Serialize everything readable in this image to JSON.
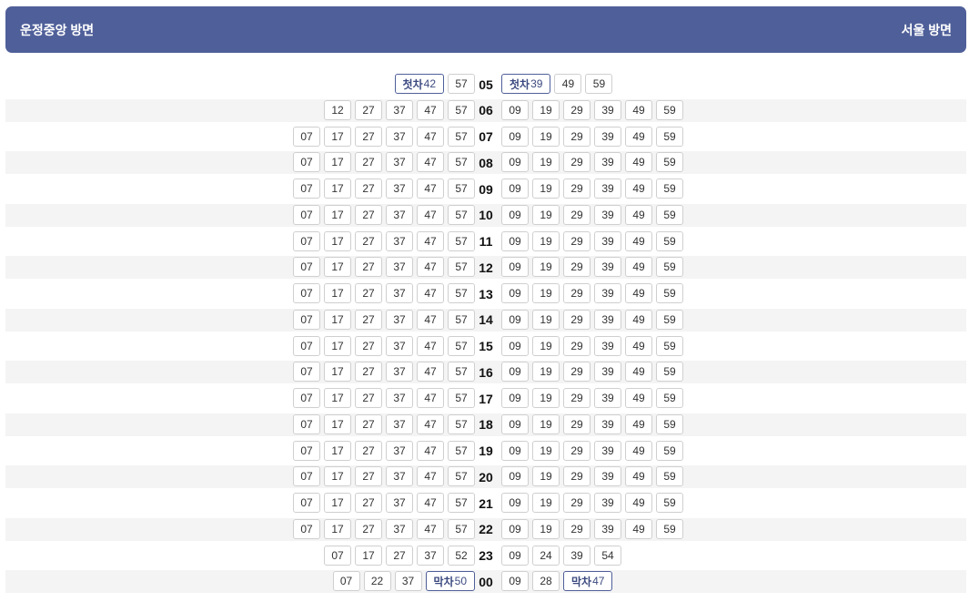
{
  "header": {
    "left_direction": "운정중앙 방면",
    "right_direction": "서울 방면"
  },
  "timetable": [
    {
      "hour": "05",
      "left": [
        {
          "t": "42",
          "label": "첫차"
        },
        {
          "t": "57"
        }
      ],
      "right": [
        {
          "t": "39",
          "label": "첫차"
        },
        {
          "t": "49"
        },
        {
          "t": "59"
        }
      ]
    },
    {
      "hour": "06",
      "left": [
        {
          "t": "12"
        },
        {
          "t": "27"
        },
        {
          "t": "37"
        },
        {
          "t": "47"
        },
        {
          "t": "57"
        }
      ],
      "right": [
        {
          "t": "09"
        },
        {
          "t": "19"
        },
        {
          "t": "29"
        },
        {
          "t": "39"
        },
        {
          "t": "49"
        },
        {
          "t": "59"
        }
      ]
    },
    {
      "hour": "07",
      "left": [
        {
          "t": "07"
        },
        {
          "t": "17"
        },
        {
          "t": "27"
        },
        {
          "t": "37"
        },
        {
          "t": "47"
        },
        {
          "t": "57"
        }
      ],
      "right": [
        {
          "t": "09"
        },
        {
          "t": "19"
        },
        {
          "t": "29"
        },
        {
          "t": "39"
        },
        {
          "t": "49"
        },
        {
          "t": "59"
        }
      ]
    },
    {
      "hour": "08",
      "left": [
        {
          "t": "07"
        },
        {
          "t": "17"
        },
        {
          "t": "27"
        },
        {
          "t": "37"
        },
        {
          "t": "47"
        },
        {
          "t": "57"
        }
      ],
      "right": [
        {
          "t": "09"
        },
        {
          "t": "19"
        },
        {
          "t": "29"
        },
        {
          "t": "39"
        },
        {
          "t": "49"
        },
        {
          "t": "59"
        }
      ]
    },
    {
      "hour": "09",
      "left": [
        {
          "t": "07"
        },
        {
          "t": "17"
        },
        {
          "t": "27"
        },
        {
          "t": "37"
        },
        {
          "t": "47"
        },
        {
          "t": "57"
        }
      ],
      "right": [
        {
          "t": "09"
        },
        {
          "t": "19"
        },
        {
          "t": "29"
        },
        {
          "t": "39"
        },
        {
          "t": "49"
        },
        {
          "t": "59"
        }
      ]
    },
    {
      "hour": "10",
      "left": [
        {
          "t": "07"
        },
        {
          "t": "17"
        },
        {
          "t": "27"
        },
        {
          "t": "37"
        },
        {
          "t": "47"
        },
        {
          "t": "57"
        }
      ],
      "right": [
        {
          "t": "09"
        },
        {
          "t": "19"
        },
        {
          "t": "29"
        },
        {
          "t": "39"
        },
        {
          "t": "49"
        },
        {
          "t": "59"
        }
      ]
    },
    {
      "hour": "11",
      "left": [
        {
          "t": "07"
        },
        {
          "t": "17"
        },
        {
          "t": "27"
        },
        {
          "t": "37"
        },
        {
          "t": "47"
        },
        {
          "t": "57"
        }
      ],
      "right": [
        {
          "t": "09"
        },
        {
          "t": "19"
        },
        {
          "t": "29"
        },
        {
          "t": "39"
        },
        {
          "t": "49"
        },
        {
          "t": "59"
        }
      ]
    },
    {
      "hour": "12",
      "left": [
        {
          "t": "07"
        },
        {
          "t": "17"
        },
        {
          "t": "27"
        },
        {
          "t": "37"
        },
        {
          "t": "47"
        },
        {
          "t": "57"
        }
      ],
      "right": [
        {
          "t": "09"
        },
        {
          "t": "19"
        },
        {
          "t": "29"
        },
        {
          "t": "39"
        },
        {
          "t": "49"
        },
        {
          "t": "59"
        }
      ]
    },
    {
      "hour": "13",
      "left": [
        {
          "t": "07"
        },
        {
          "t": "17"
        },
        {
          "t": "27"
        },
        {
          "t": "37"
        },
        {
          "t": "47"
        },
        {
          "t": "57"
        }
      ],
      "right": [
        {
          "t": "09"
        },
        {
          "t": "19"
        },
        {
          "t": "29"
        },
        {
          "t": "39"
        },
        {
          "t": "49"
        },
        {
          "t": "59"
        }
      ]
    },
    {
      "hour": "14",
      "left": [
        {
          "t": "07"
        },
        {
          "t": "17"
        },
        {
          "t": "27"
        },
        {
          "t": "37"
        },
        {
          "t": "47"
        },
        {
          "t": "57"
        }
      ],
      "right": [
        {
          "t": "09"
        },
        {
          "t": "19"
        },
        {
          "t": "29"
        },
        {
          "t": "39"
        },
        {
          "t": "49"
        },
        {
          "t": "59"
        }
      ]
    },
    {
      "hour": "15",
      "left": [
        {
          "t": "07"
        },
        {
          "t": "17"
        },
        {
          "t": "27"
        },
        {
          "t": "37"
        },
        {
          "t": "47"
        },
        {
          "t": "57"
        }
      ],
      "right": [
        {
          "t": "09"
        },
        {
          "t": "19"
        },
        {
          "t": "29"
        },
        {
          "t": "39"
        },
        {
          "t": "49"
        },
        {
          "t": "59"
        }
      ]
    },
    {
      "hour": "16",
      "left": [
        {
          "t": "07"
        },
        {
          "t": "17"
        },
        {
          "t": "27"
        },
        {
          "t": "37"
        },
        {
          "t": "47"
        },
        {
          "t": "57"
        }
      ],
      "right": [
        {
          "t": "09"
        },
        {
          "t": "19"
        },
        {
          "t": "29"
        },
        {
          "t": "39"
        },
        {
          "t": "49"
        },
        {
          "t": "59"
        }
      ]
    },
    {
      "hour": "17",
      "left": [
        {
          "t": "07"
        },
        {
          "t": "17"
        },
        {
          "t": "27"
        },
        {
          "t": "37"
        },
        {
          "t": "47"
        },
        {
          "t": "57"
        }
      ],
      "right": [
        {
          "t": "09"
        },
        {
          "t": "19"
        },
        {
          "t": "29"
        },
        {
          "t": "39"
        },
        {
          "t": "49"
        },
        {
          "t": "59"
        }
      ]
    },
    {
      "hour": "18",
      "left": [
        {
          "t": "07"
        },
        {
          "t": "17"
        },
        {
          "t": "27"
        },
        {
          "t": "37"
        },
        {
          "t": "47"
        },
        {
          "t": "57"
        }
      ],
      "right": [
        {
          "t": "09"
        },
        {
          "t": "19"
        },
        {
          "t": "29"
        },
        {
          "t": "39"
        },
        {
          "t": "49"
        },
        {
          "t": "59"
        }
      ]
    },
    {
      "hour": "19",
      "left": [
        {
          "t": "07"
        },
        {
          "t": "17"
        },
        {
          "t": "27"
        },
        {
          "t": "37"
        },
        {
          "t": "47"
        },
        {
          "t": "57"
        }
      ],
      "right": [
        {
          "t": "09"
        },
        {
          "t": "19"
        },
        {
          "t": "29"
        },
        {
          "t": "39"
        },
        {
          "t": "49"
        },
        {
          "t": "59"
        }
      ]
    },
    {
      "hour": "20",
      "left": [
        {
          "t": "07"
        },
        {
          "t": "17"
        },
        {
          "t": "27"
        },
        {
          "t": "37"
        },
        {
          "t": "47"
        },
        {
          "t": "57"
        }
      ],
      "right": [
        {
          "t": "09"
        },
        {
          "t": "19"
        },
        {
          "t": "29"
        },
        {
          "t": "39"
        },
        {
          "t": "49"
        },
        {
          "t": "59"
        }
      ]
    },
    {
      "hour": "21",
      "left": [
        {
          "t": "07"
        },
        {
          "t": "17"
        },
        {
          "t": "27"
        },
        {
          "t": "37"
        },
        {
          "t": "47"
        },
        {
          "t": "57"
        }
      ],
      "right": [
        {
          "t": "09"
        },
        {
          "t": "19"
        },
        {
          "t": "29"
        },
        {
          "t": "39"
        },
        {
          "t": "49"
        },
        {
          "t": "59"
        }
      ]
    },
    {
      "hour": "22",
      "left": [
        {
          "t": "07"
        },
        {
          "t": "17"
        },
        {
          "t": "27"
        },
        {
          "t": "37"
        },
        {
          "t": "47"
        },
        {
          "t": "57"
        }
      ],
      "right": [
        {
          "t": "09"
        },
        {
          "t": "19"
        },
        {
          "t": "29"
        },
        {
          "t": "39"
        },
        {
          "t": "49"
        },
        {
          "t": "59"
        }
      ]
    },
    {
      "hour": "23",
      "left": [
        {
          "t": "07"
        },
        {
          "t": "17"
        },
        {
          "t": "27"
        },
        {
          "t": "37"
        },
        {
          "t": "52"
        }
      ],
      "right": [
        {
          "t": "09"
        },
        {
          "t": "24"
        },
        {
          "t": "39"
        },
        {
          "t": "54"
        }
      ]
    },
    {
      "hour": "00",
      "left": [
        {
          "t": "07"
        },
        {
          "t": "22"
        },
        {
          "t": "37"
        },
        {
          "t": "50",
          "label": "막차"
        }
      ],
      "right": [
        {
          "t": "09"
        },
        {
          "t": "28"
        },
        {
          "t": "47",
          "label": "막차"
        }
      ]
    }
  ],
  "colors": {
    "header_bg": "#4f5f99",
    "special_border": "#4f5f99",
    "shaded_row": "#f4f4f4"
  }
}
